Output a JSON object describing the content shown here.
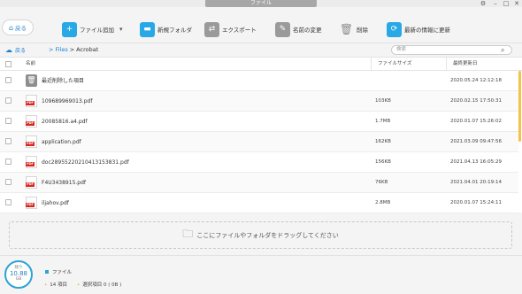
{
  "window": {
    "title": "ファイル"
  },
  "toolbar": {
    "back_label": "戻る",
    "add_label": "ファイル追加",
    "new_folder_label": "新規フォルダ",
    "export_label": "エクスポート",
    "rename_label": "名前の変更",
    "delete_label": "削除",
    "refresh_label": "最新の情報に更新"
  },
  "nav": {
    "back_label": "戻る",
    "breadcrumb": {
      "root": "Files",
      "sep": ">",
      "current": "Acrobat"
    },
    "search_placeholder": "検索"
  },
  "table": {
    "headers": {
      "name": "名前",
      "size": "ファイルサイズ",
      "date": "最終更新日"
    },
    "rows": [
      {
        "icon": "trash-icon",
        "name": "最近削除した項目",
        "size": "",
        "date": "2020.05.24 12:12:18"
      },
      {
        "icon": "pdf-icon",
        "name": "109689969013.pdf",
        "size": "103KB",
        "date": "2020.02.15 17:50:31"
      },
      {
        "icon": "pdf-icon",
        "name": "20085816.a4.pdf",
        "size": "1.7MB",
        "date": "2020.01.07 15:26:02"
      },
      {
        "icon": "pdf-icon",
        "name": "application.pdf",
        "size": "162KB",
        "date": "2021.03.09 09:47:56"
      },
      {
        "icon": "pdf-icon",
        "name": "doc28955220210413153831.pdf",
        "size": "156KB",
        "date": "2021.04.13 16:05:29"
      },
      {
        "icon": "pdf-icon",
        "name": "F4U3438915.pdf",
        "size": "76KB",
        "date": "2021.04.01 20:19:14"
      },
      {
        "icon": "pdf-icon",
        "name": "iljahov.pdf",
        "size": "2.8MB",
        "date": "2020.01.07 15:24:11"
      }
    ]
  },
  "dropzone": {
    "text": "ここにファイルやフォルダをドラッグしてください"
  },
  "footer": {
    "storage_top": "残り",
    "storage_value": "10.88",
    "storage_unit": "GB",
    "legend_label": "ファイル",
    "count": "14 項目",
    "selected": "選択項目 0 ( 0B )"
  },
  "colors": {
    "accent": "#28a8e4",
    "pdf": "#d9271f",
    "scroll": "#f3c24a"
  }
}
